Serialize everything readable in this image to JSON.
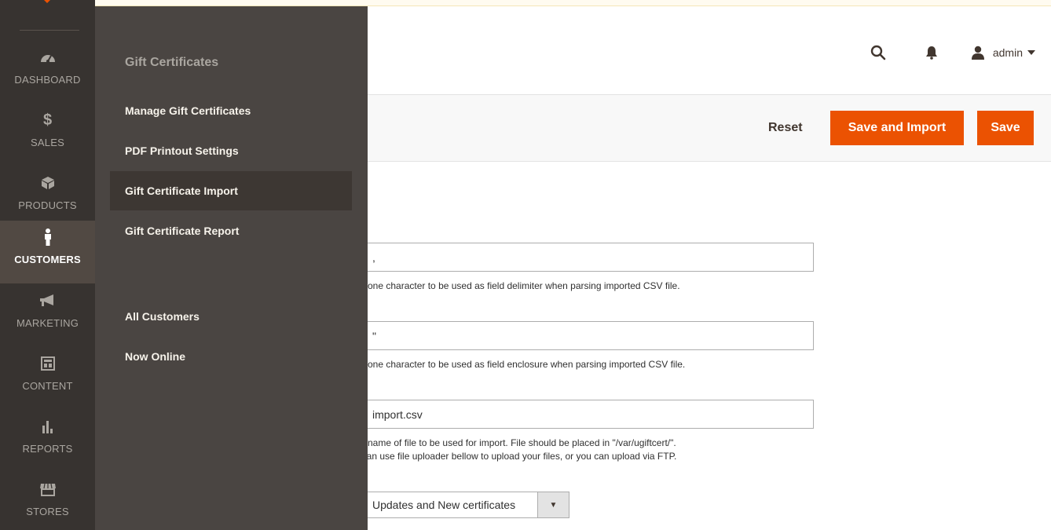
{
  "header": {
    "username": "admin"
  },
  "toolbar": {
    "reset_label": "Reset",
    "save_import_label": "Save and Import",
    "save_label": "Save"
  },
  "form": {
    "delimiter_value": ",",
    "delimiter_note": "nter one character to be used as field delimiter when parsing imported CSV file.",
    "enclosure_value": "\"",
    "enclosure_note": "nter one character to be used as field enclosure when parsing imported CSV file.",
    "filename_value": "import.csv",
    "filename_note_line1": "nter name of file to be used for import. File should be placed in \"/var/ugiftcert/\".",
    "filename_note_line2": "ou can use file uploader bellow to upload your files, or you can upload via FTP.",
    "import_mode_value": "Updates and New certificates"
  },
  "nav": {
    "items": [
      {
        "label": "DASHBOARD",
        "icon": "gauge-icon"
      },
      {
        "label": "SALES",
        "icon": "dollar-icon"
      },
      {
        "label": "PRODUCTS",
        "icon": "box-icon"
      },
      {
        "label": "CUSTOMERS",
        "icon": "person-icon"
      },
      {
        "label": "MARKETING",
        "icon": "megaphone-icon"
      },
      {
        "label": "CONTENT",
        "icon": "layout-icon"
      },
      {
        "label": "REPORTS",
        "icon": "bar-chart-icon"
      },
      {
        "label": "STORES",
        "icon": "store-icon"
      }
    ]
  },
  "flyout": {
    "section_title": "Gift Certificates",
    "items": [
      {
        "label": "Manage Gift Certificates"
      },
      {
        "label": "PDF Printout Settings"
      },
      {
        "label": "Gift Certificate Import"
      },
      {
        "label": "Gift Certificate Report"
      },
      {
        "label": "All Customers"
      },
      {
        "label": "Now Online"
      }
    ]
  },
  "colors": {
    "accent": "#eb5202",
    "nav_bg": "#373330",
    "flyout_bg": "#4a4542"
  }
}
